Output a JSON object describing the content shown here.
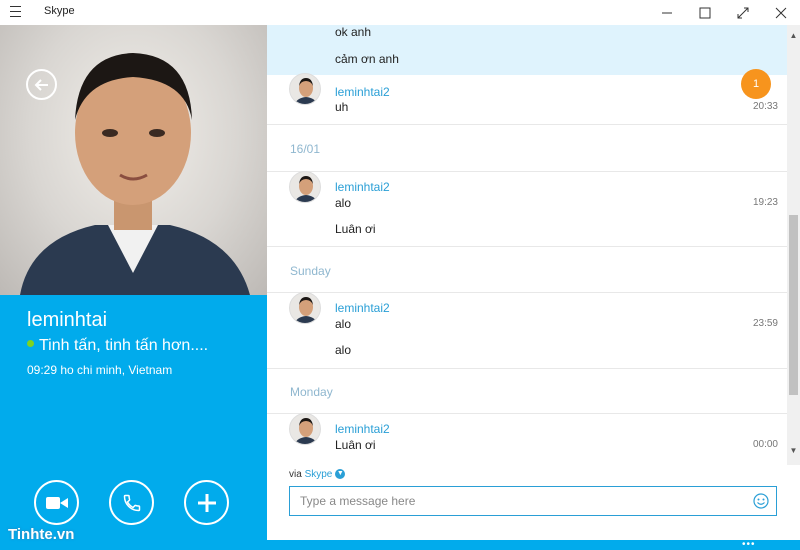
{
  "window": {
    "title": "Skype"
  },
  "profile": {
    "name": "leminhtai",
    "mood": "Tinh tấn, tinh tấn hơn....",
    "local_time": "09:29 ho chi minh, Vietnam"
  },
  "conversation": {
    "top_lines": [
      "ok anh",
      "cảm ơn anh"
    ],
    "unread_badge": "1",
    "messages": [
      {
        "sender": "leminhtai2",
        "text": "uh",
        "time": "20:33"
      },
      {
        "date": "16/01"
      },
      {
        "sender": "leminhtai2",
        "text": "alo",
        "time": "19:23",
        "extra": "Luân ơi"
      },
      {
        "date": "Sunday"
      },
      {
        "sender": "leminhtai2",
        "text": "alo",
        "time": "23:59",
        "extra": "alo"
      },
      {
        "date": "Monday"
      },
      {
        "sender": "leminhtai2",
        "text": "Luân ơi",
        "time": "00:00"
      }
    ]
  },
  "composer": {
    "via_prefix": "via",
    "via_service": "Skype",
    "placeholder": "Type a message here"
  },
  "footer": {
    "watermark": "Tinhte.vn",
    "more": "•••"
  },
  "colors": {
    "accent": "#01abec",
    "link": "#2a9fd6",
    "badge": "#f7941d",
    "highlight": "#dff3fd"
  }
}
